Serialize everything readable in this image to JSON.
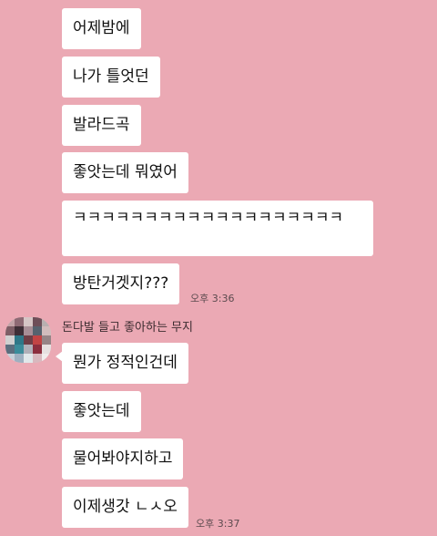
{
  "messages": [
    {
      "text": "어제밤에"
    },
    {
      "text": "나가 틀엇던"
    },
    {
      "text": "발라드곡"
    },
    {
      "text": "좋앗는데 뭐였어"
    },
    {
      "text": "ㅋㅋㅋㅋㅋㅋㅋㅋㅋㅋㅋㅋㅋㅋㅋㅋㅋㅋㅋ"
    },
    {
      "text": "방탄거겟지???",
      "time": "오후 3:36"
    },
    {
      "text": "뭔가 정적인건데"
    },
    {
      "text": "좋앗는데"
    },
    {
      "text": "물어봐야지하고"
    },
    {
      "text": "이제생갓 ㄴㅅ오",
      "time": "오후 3:37"
    }
  ],
  "sender": {
    "name": "돈다발 들고 좋아하는 무지",
    "avatar_icon": "pixelated-profile-avatar",
    "avatar_colors": [
      "#c2a2a6",
      "#8e6a74",
      "#d6c6c6",
      "#6e4e58",
      "#b8b0b0",
      "#7e5e66",
      "#3e2e36",
      "#a88e96",
      "#56626e",
      "#d2bcbc",
      "#d0d0d0",
      "#2e7888",
      "#6e3e46",
      "#c24444",
      "#968486",
      "#5c6e7e",
      "#3a8c9a",
      "#b0b0b8",
      "#8c2e3e",
      "#e6e0e0",
      "#c8d0d8",
      "#9eb0c0",
      "#e0e8ea",
      "#d8b8be",
      "#f0ecec"
    ]
  },
  "theme": {
    "background": "#eba9b4",
    "bubble": "#ffffff"
  }
}
